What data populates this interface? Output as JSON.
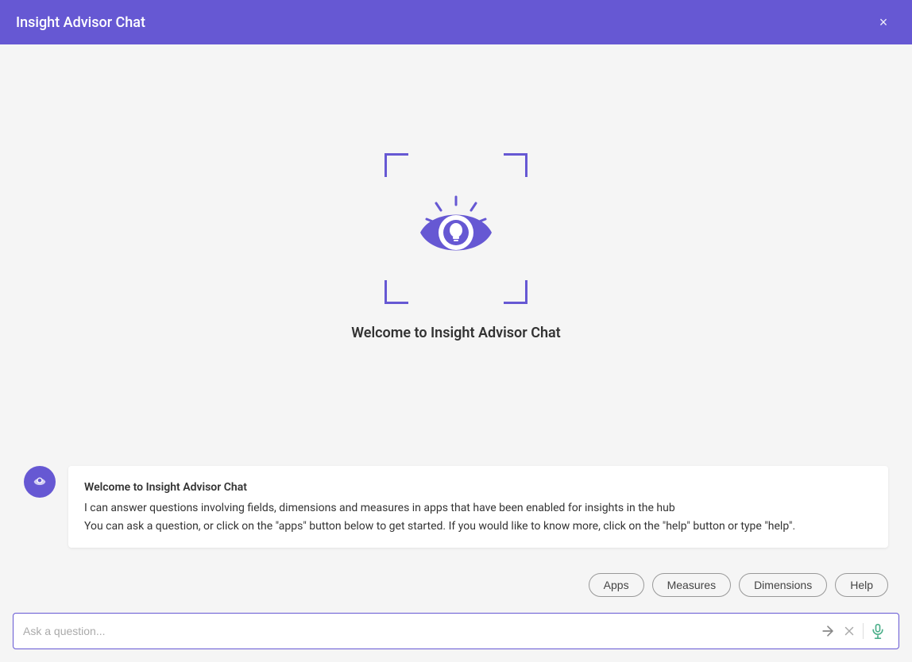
{
  "header": {
    "title": "Insight Advisor Chat",
    "close_label": "×"
  },
  "welcome": {
    "text": "Welcome to Insight Advisor Chat"
  },
  "message": {
    "title": "Welcome to Insight Advisor Chat",
    "line1": "I can answer questions involving fields, dimensions and measures in apps that have been enabled for insights in the hub",
    "line2": "You can ask a question, or click on the \"apps\" button below to get started. If you would like to know more, click on the \"help\" button or type \"help\"."
  },
  "action_buttons": [
    {
      "label": "Apps",
      "name": "apps-button"
    },
    {
      "label": "Measures",
      "name": "measures-button"
    },
    {
      "label": "Dimensions",
      "name": "dimensions-button"
    },
    {
      "label": "Help",
      "name": "help-button"
    }
  ],
  "input": {
    "placeholder": "Ask a question..."
  },
  "colors": {
    "purple": "#6658d3",
    "green": "#4caf8a"
  }
}
